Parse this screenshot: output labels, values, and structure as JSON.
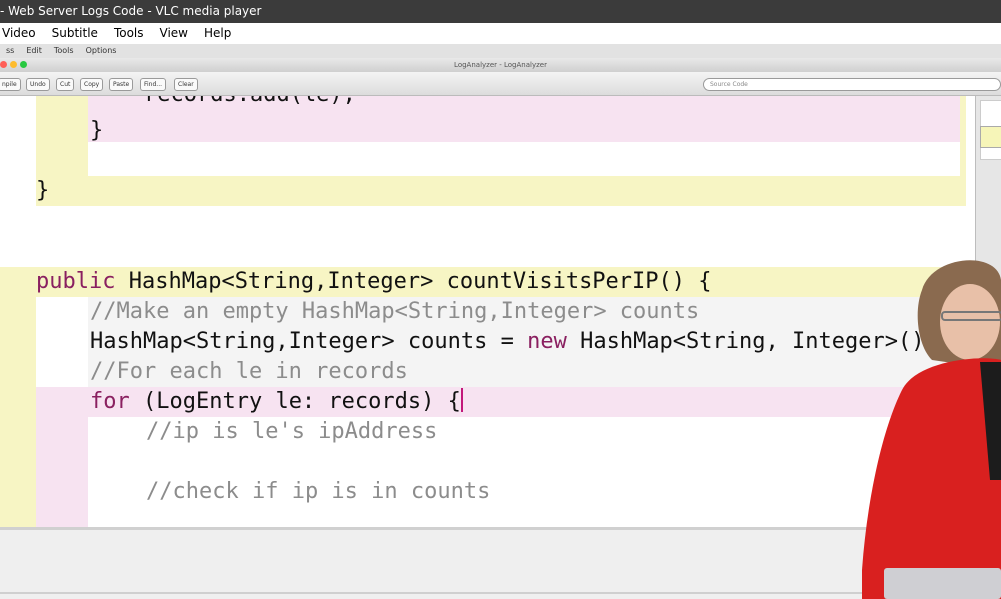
{
  "window": {
    "title": "- Web Server Logs Code - VLC media player"
  },
  "vlc_menu": [
    "Video",
    "Subtitle",
    "Tools",
    "View",
    "Help"
  ],
  "app": {
    "menu": [
      "ss",
      "Edit",
      "Tools",
      "Options"
    ],
    "title": "LogAnalyzer - LogAnalyzer",
    "toolbar": [
      "npile",
      "Undo",
      "Cut",
      "Copy",
      "Paste",
      "Find...",
      "Clear"
    ],
    "search_placeholder": "Source Code"
  },
  "code": {
    "l1": "records.add(le);",
    "l2": "}",
    "l3": "}",
    "l4_kw": "public",
    "l4_rest": " HashMap<String,Integer> countVisitsPerIP() {",
    "l5": "//Make an empty HashMap<String,Integer> counts",
    "l6_a": "HashMap<String,Integer> counts = ",
    "l6_kw": "new",
    "l6_b": " HashMap<String, Integer>()",
    "l7": "//For each le in records",
    "l8_kw": "for",
    "l8_rest": " (LogEntry le: records) {",
    "l9": "//ip is le's ipAddress",
    "l10": "//check if ip is in counts"
  },
  "colors": {
    "yellow_band": "#f7f5c4",
    "pink_band": "#f7e3f1",
    "keyword": "#8a2060",
    "comment": "#8c8c8c"
  }
}
